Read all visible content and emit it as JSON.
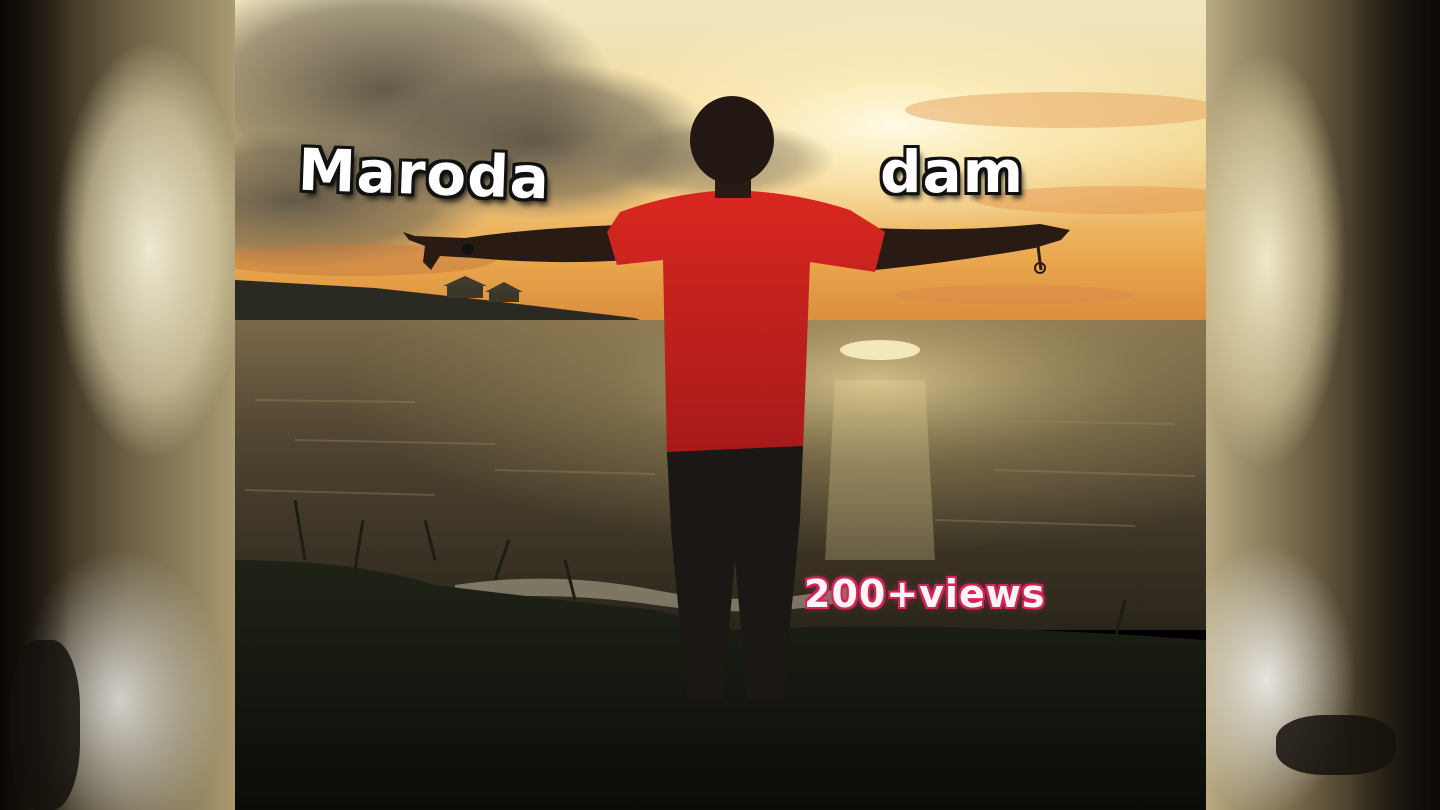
{
  "captions": {
    "title_left": "Maroda",
    "title_right": "dam",
    "views": "200+views"
  },
  "colors": {
    "sky_top": "#f6ecc4",
    "sky_glow": "#fff6d6",
    "horizon_orange": "#e9a54c",
    "water": "#6a5b3f",
    "shirt_red": "#c8201f",
    "views_outline": "#d6245a"
  }
}
